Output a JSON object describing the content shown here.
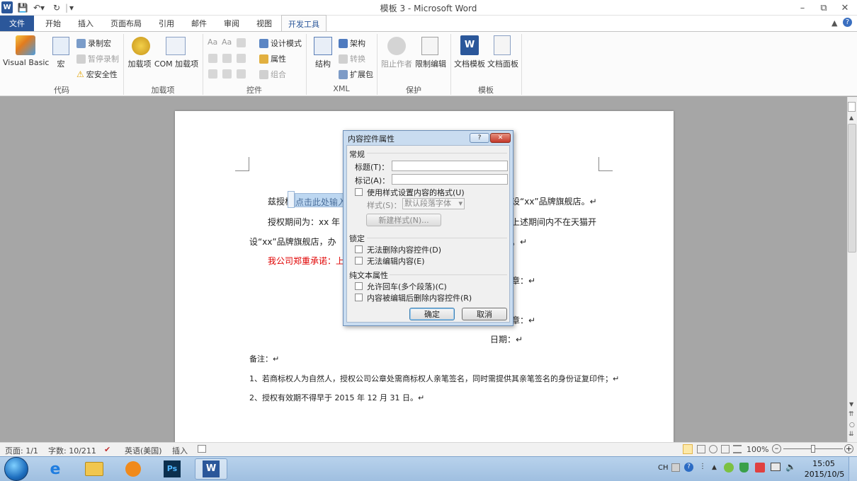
{
  "window": {
    "title": "模板 3 - Microsoft Word",
    "qat_sep": "|"
  },
  "tabs": [
    "文件",
    "开始",
    "插入",
    "页面布局",
    "引用",
    "邮件",
    "审阅",
    "视图",
    "开发工具"
  ],
  "ribbon": {
    "groups": {
      "code": "代码",
      "addins": "加载项",
      "controls": "控件",
      "xml": "XML",
      "protect": "保护",
      "template": "模板"
    },
    "code": {
      "vb": "Visual Basic",
      "macro": "宏",
      "record": "录制宏",
      "pause": "暂停录制",
      "security": "宏安全性"
    },
    "addins": {
      "addin": "加载项",
      "com": "COM 加载项"
    },
    "controls": {
      "design": "设计模式",
      "props": "属性",
      "group": "组合"
    },
    "xml": {
      "structure": "结构",
      "schema": "架构",
      "transform": "转换",
      "expansion": "扩展包"
    },
    "protect": {
      "block": "阻止作者",
      "restrict": "限制编辑"
    },
    "template": {
      "doc_template": "文档模板",
      "doc_panel": "文档面板"
    }
  },
  "document": {
    "line1_prefix": "兹授权",
    "placeholder": "点击此处输入",
    "line1_suffix": "设“xx”品牌旗舰店。↵",
    "line2_prefix": "授权期间为：xx 年 x",
    "line2_suffix": "上述期间内不在天猫开",
    "line3_prefix": "设“xx”品牌旗舰店，办",
    "line3_suffix": "。↵",
    "line4_red": "我公司郑重承诺：上",
    "seal1": "章：↵",
    "seal2": "章：↵",
    "date": "日期：↵",
    "note_title": "备注：↵",
    "note1": "1、若商标权人为自然人，授权公司公章处需商标权人亲笔签名，同时需提供其亲笔签名的身份证复印件；↵",
    "note2": "2、授权有效期不得早于 2015 年 12 月 31 日。↵"
  },
  "dialog": {
    "title": "内容控件属性",
    "help": "?",
    "close": "✕",
    "sec_general": "常规",
    "title_label": "标题(T)：",
    "tag_label": "标记(A)：",
    "title_value": "",
    "tag_value": "",
    "use_style": "使用样式设置内容的格式(U)",
    "style_label": "样式(S)：",
    "style_value": "默认段落字体",
    "new_style": "新建样式(N)...",
    "sec_lock": "锁定",
    "no_delete": "无法删除内容控件(D)",
    "no_edit": "无法编辑内容(E)",
    "sec_plain": "纯文本属性",
    "allow_cr": "允许回车(多个段落)(C)",
    "remove_after": "内容被编辑后删除内容控件(R)",
    "ok": "确定",
    "cancel": "取消"
  },
  "status": {
    "page": "页面: 1/1",
    "words": "字数: 10/211",
    "lang": "英语(美国)",
    "mode": "插入",
    "zoom": "100%"
  },
  "taskbar": {
    "ime": "CH",
    "time": "15:05",
    "date": "2015/10/5"
  },
  "colors": {
    "word_blue": "#2b579a",
    "red_text": "#e00000",
    "placeholder_bg": "#bdd7f1"
  }
}
